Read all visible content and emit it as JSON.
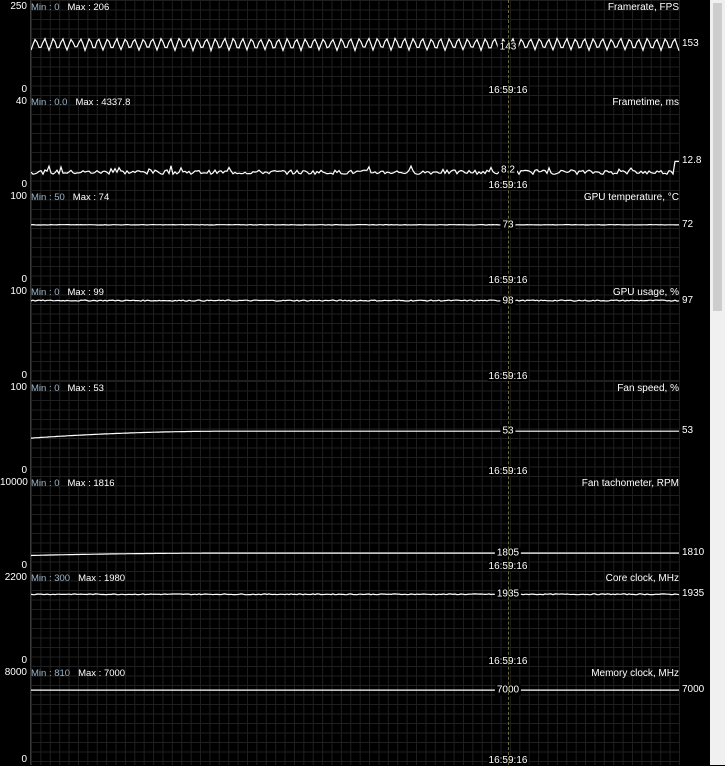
{
  "cursor_time": "16:59:16",
  "graphs": [
    {
      "id": "framerate",
      "title": "Framerate, FPS",
      "min_label": "Min : 0",
      "max_label": "Max : 206",
      "ymax": "250",
      "ymin": "0",
      "ymax_value": 250,
      "cursor_value": "143",
      "current_value": "153",
      "series": {
        "kind": "zigzag",
        "base": 153,
        "amp": 20,
        "period": 9
      },
      "cursor_value_y": 143
    },
    {
      "id": "frametime",
      "title": "Frametime, ms",
      "min_label": "Min : 0.0",
      "max_label": "Max : 4337.8",
      "ymax": "40",
      "ymin": "0",
      "ymax_value": 40,
      "cursor_value": "8.2",
      "current_value": "12.8",
      "series": {
        "kind": "noisy",
        "base": 7.2,
        "amp": 2.2,
        "spike": 12.8
      },
      "cursor_value_y": 8.2
    },
    {
      "id": "gpu-temp",
      "title": "GPU temperature, °C",
      "min_label": "Min : 50",
      "max_label": "Max : 74",
      "ymax": "100",
      "ymin": "0",
      "ymax_value": 100,
      "cursor_value": "73",
      "current_value": "72",
      "series": {
        "kind": "flat",
        "base": 73,
        "amp": 0.3
      },
      "cursor_value_y": 73
    },
    {
      "id": "gpu-usage",
      "title": "GPU usage, %",
      "min_label": "Min : 0",
      "max_label": "Max : 99",
      "ymax": "100",
      "ymin": "0",
      "ymax_value": 100,
      "cursor_value": "98",
      "current_value": "97",
      "series": {
        "kind": "flat",
        "base": 98,
        "amp": 0.7
      },
      "cursor_value_y": 98
    },
    {
      "id": "fan-speed",
      "title": "Fan speed, %",
      "min_label": "Min : 0",
      "max_label": "Max : 53",
      "ymax": "100",
      "ymin": "0",
      "ymax_value": 100,
      "cursor_value": "53",
      "current_value": "53",
      "series": {
        "kind": "ramp",
        "start": 44,
        "base": 53
      },
      "cursor_value_y": 53
    },
    {
      "id": "fan-tach",
      "title": "Fan tachometer, RPM",
      "min_label": "Min : 0",
      "max_label": "Max : 1816",
      "ymax": "10000",
      "ymin": "0",
      "ymax_value": 10000,
      "cursor_value": "1805",
      "current_value": "1810",
      "series": {
        "kind": "ramp",
        "start": 1500,
        "base": 1805
      },
      "cursor_value_y": 1805
    },
    {
      "id": "core-clock",
      "title": "Core clock, MHz",
      "min_label": "Min : 300",
      "max_label": "Max : 1980",
      "ymax": "2200",
      "ymin": "0",
      "ymax_value": 2200,
      "cursor_value": "1935",
      "current_value": "1935",
      "series": {
        "kind": "flat",
        "base": 1935,
        "amp": 12
      },
      "cursor_value_y": 1935
    },
    {
      "id": "memory-clock",
      "title": "Memory clock, MHz",
      "min_label": "Min : 810",
      "max_label": "Max : 7000",
      "ymax": "8000",
      "ymin": "0",
      "ymax_value": 8000,
      "cursor_value": "7000",
      "current_value": "7000",
      "series": {
        "kind": "flat",
        "base": 7000,
        "amp": 0
      },
      "cursor_value_y": 7000
    }
  ]
}
